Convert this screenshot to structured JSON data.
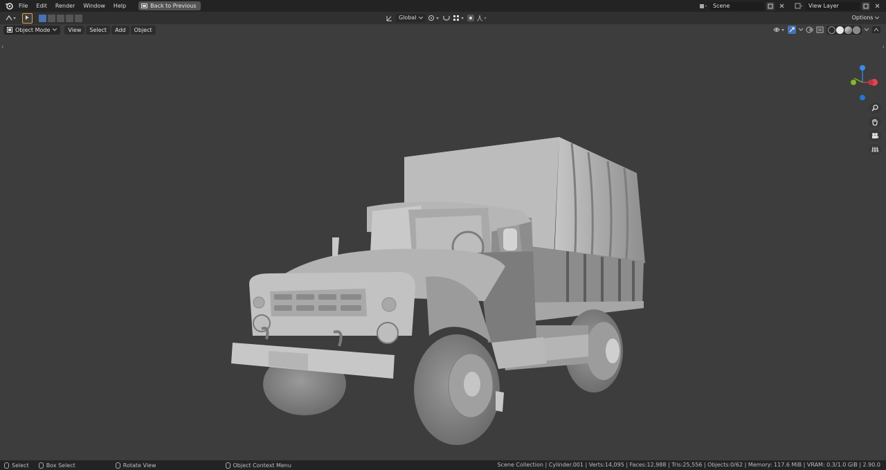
{
  "menu": {
    "items": [
      "File",
      "Edit",
      "Render",
      "Window",
      "Help"
    ],
    "back_button": "Back to Previous"
  },
  "topright": {
    "scene_name": "Scene",
    "view_layer_name": "View Layer"
  },
  "toolheader": {
    "orientation": "Global",
    "options": "Options"
  },
  "viewport_header": {
    "mode": "Object Mode",
    "view": "View",
    "select": "Select",
    "add": "Add",
    "object": "Object"
  },
  "gizmo": {
    "x_label": "X",
    "y_label": "Y",
    "z_label": "Z",
    "x_color": "#e8434f",
    "y_color": "#7fb828",
    "z_color": "#3a8ae8"
  },
  "nav_icons": [
    "zoom-icon",
    "hand-icon",
    "camera-icon",
    "grid-icon"
  ],
  "statusbar": {
    "select": "Select",
    "box_select": "Box Select",
    "rotate_view": "Rotate View",
    "context_menu": "Object Context Menu",
    "stats": "Scene Collection | Cylinder.001 | Verts:14,095 | Faces:12,988 | Tris:25,556 | Objects:0/62 | Memory: 117.6 MiB | VRAM: 0.3/1.0 GiB | 2.90.0"
  },
  "colors": {
    "viewport_bg": "#3d3d3d",
    "header_bg": "#232323",
    "accent": "#4772b3",
    "active_tool_outline": "#e8a33d"
  }
}
